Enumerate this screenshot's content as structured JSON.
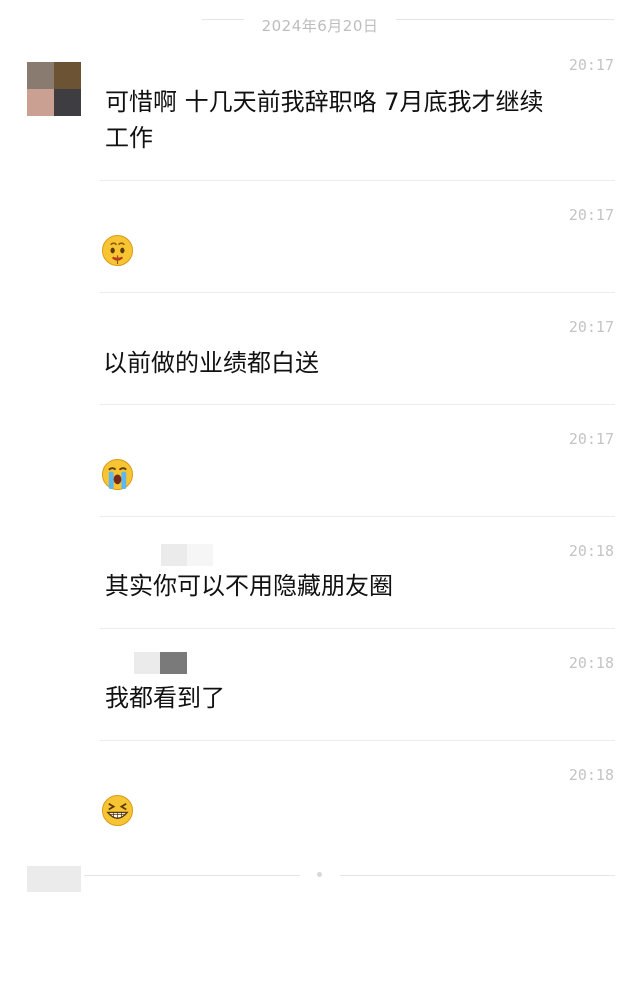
{
  "date_separator": "2024年6月20日",
  "messages": [
    {
      "time": "20:17",
      "text": "可惜啊 十几天前我辞职咯 7月底我才继续",
      "text2": "工作"
    },
    {
      "time": "20:17",
      "emoji": "money-mouth-face-icon"
    },
    {
      "time": "20:17",
      "text": "以前做的业绩都白送"
    },
    {
      "time": "20:17",
      "emoji": "loudly-crying-face-icon"
    },
    {
      "time": "20:18",
      "text": "其实你可以不用隐藏朋友圈"
    },
    {
      "time": "20:18",
      "text": "我都看到了"
    },
    {
      "time": "20:18",
      "emoji": "grinning-squinting-face-icon"
    }
  ],
  "colors": {
    "background": "#ffffff",
    "timestamp": "#c4c4c4",
    "divider": "#ececec",
    "emoji_yellow": "#f7c531"
  }
}
